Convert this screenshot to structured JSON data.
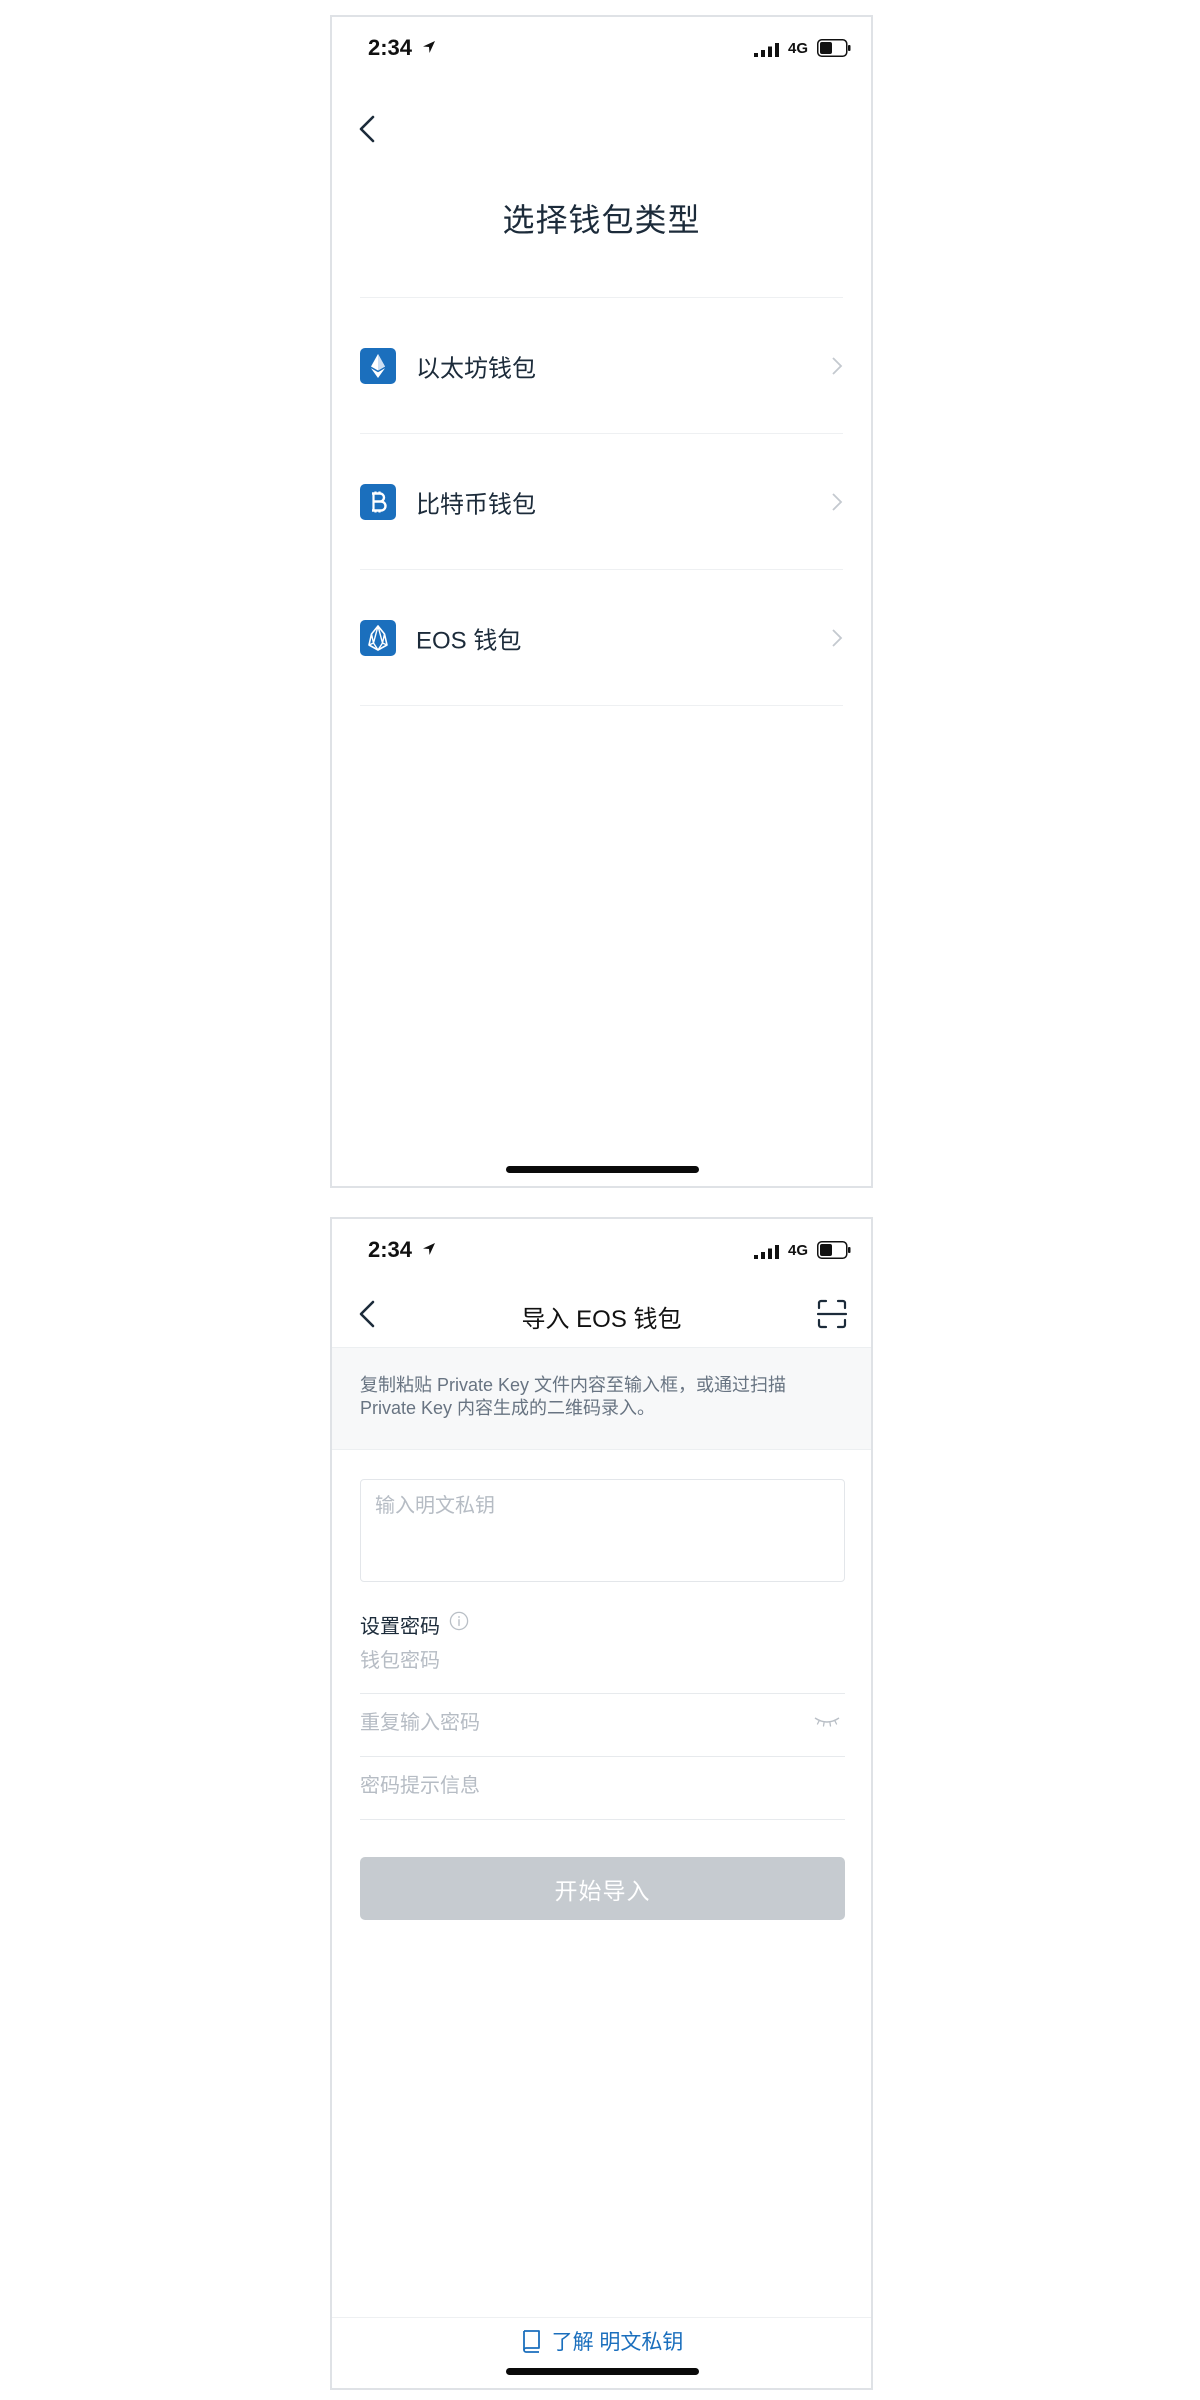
{
  "status_bar": {
    "time": "2:34",
    "network": "4G"
  },
  "screen1": {
    "title": "选择钱包类型",
    "wallets": [
      {
        "label": "以太坊钱包",
        "icon": "ethereum-icon"
      },
      {
        "label": "比特币钱包",
        "icon": "bitcoin-icon"
      },
      {
        "label": "EOS 钱包",
        "icon": "eos-icon"
      }
    ]
  },
  "screen2": {
    "title": "导入 EOS 钱包",
    "hint": "复制粘贴 Private Key 文件内容至输入框，或通过扫描 Private Key 内容生成的二维码录入。",
    "private_key_placeholder": "输入明文私钥",
    "password_section_label": "设置密码",
    "wallet_password_placeholder": "钱包密码",
    "repeat_password_placeholder": "重复输入密码",
    "password_hint_placeholder": "密码提示信息",
    "submit_label": "开始导入",
    "learn_link": "了解 明文私钥"
  },
  "colors": {
    "brand_blue": "#1b6fbd",
    "disabled_button": "#c6cbd0",
    "text_primary": "#1c2b3a",
    "placeholder": "#b6bcc4"
  }
}
